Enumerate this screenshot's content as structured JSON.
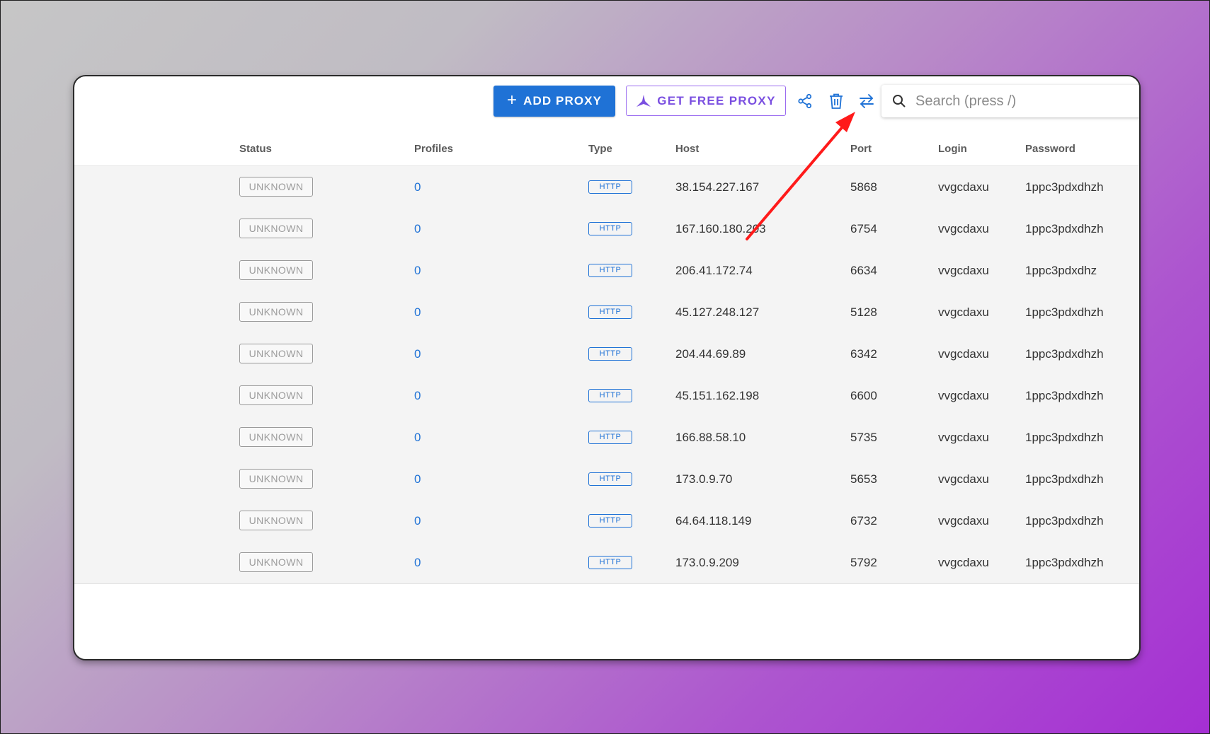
{
  "toolbar": {
    "add_label": "ADD PROXY",
    "add_plus": "+",
    "free_label": "GET FREE PROXY",
    "search_placeholder": "Search (press /)"
  },
  "icons": {
    "add": "plus-icon",
    "free": "free-proxy-logo-icon",
    "share": "share-icon",
    "delete": "trash-icon",
    "swap": "swap-arrows-icon",
    "search": "search-icon",
    "annotation": "red-arrow-annotation"
  },
  "colors": {
    "primary": "#1f72d6",
    "accent_purple": "#7a4fe0",
    "annotation_red": "#ff1a1a"
  },
  "table": {
    "headers": [
      "Status",
      "Profiles",
      "Type",
      "Host",
      "Port",
      "Login",
      "Password"
    ],
    "rows": [
      {
        "status": "UNKNOWN",
        "profiles": "0",
        "type": "HTTP",
        "host": "38.154.227.167",
        "port": "5868",
        "login": "vvgcdaxu",
        "password": "1ppc3pdxdhzh"
      },
      {
        "status": "UNKNOWN",
        "profiles": "0",
        "type": "HTTP",
        "host": "167.160.180.203",
        "port": "6754",
        "login": "vvgcdaxu",
        "password": "1ppc3pdxdhzh"
      },
      {
        "status": "UNKNOWN",
        "profiles": "0",
        "type": "HTTP",
        "host": "206.41.172.74",
        "port": "6634",
        "login": "vvgcdaxu",
        "password": "1ppc3pdxdhz"
      },
      {
        "status": "UNKNOWN",
        "profiles": "0",
        "type": "HTTP",
        "host": "45.127.248.127",
        "port": "5128",
        "login": "vvgcdaxu",
        "password": "1ppc3pdxdhzh"
      },
      {
        "status": "UNKNOWN",
        "profiles": "0",
        "type": "HTTP",
        "host": "204.44.69.89",
        "port": "6342",
        "login": "vvgcdaxu",
        "password": "1ppc3pdxdhzh"
      },
      {
        "status": "UNKNOWN",
        "profiles": "0",
        "type": "HTTP",
        "host": "45.151.162.198",
        "port": "6600",
        "login": "vvgcdaxu",
        "password": "1ppc3pdxdhzh"
      },
      {
        "status": "UNKNOWN",
        "profiles": "0",
        "type": "HTTP",
        "host": "166.88.58.10",
        "port": "5735",
        "login": "vvgcdaxu",
        "password": "1ppc3pdxdhzh"
      },
      {
        "status": "UNKNOWN",
        "profiles": "0",
        "type": "HTTP",
        "host": "173.0.9.70",
        "port": "5653",
        "login": "vvgcdaxu",
        "password": "1ppc3pdxdhzh"
      },
      {
        "status": "UNKNOWN",
        "profiles": "0",
        "type": "HTTP",
        "host": "64.64.118.149",
        "port": "6732",
        "login": "vvgcdaxu",
        "password": "1ppc3pdxdhzh"
      },
      {
        "status": "UNKNOWN",
        "profiles": "0",
        "type": "HTTP",
        "host": "173.0.9.209",
        "port": "5792",
        "login": "vvgcdaxu",
        "password": "1ppc3pdxdhzh"
      }
    ]
  }
}
